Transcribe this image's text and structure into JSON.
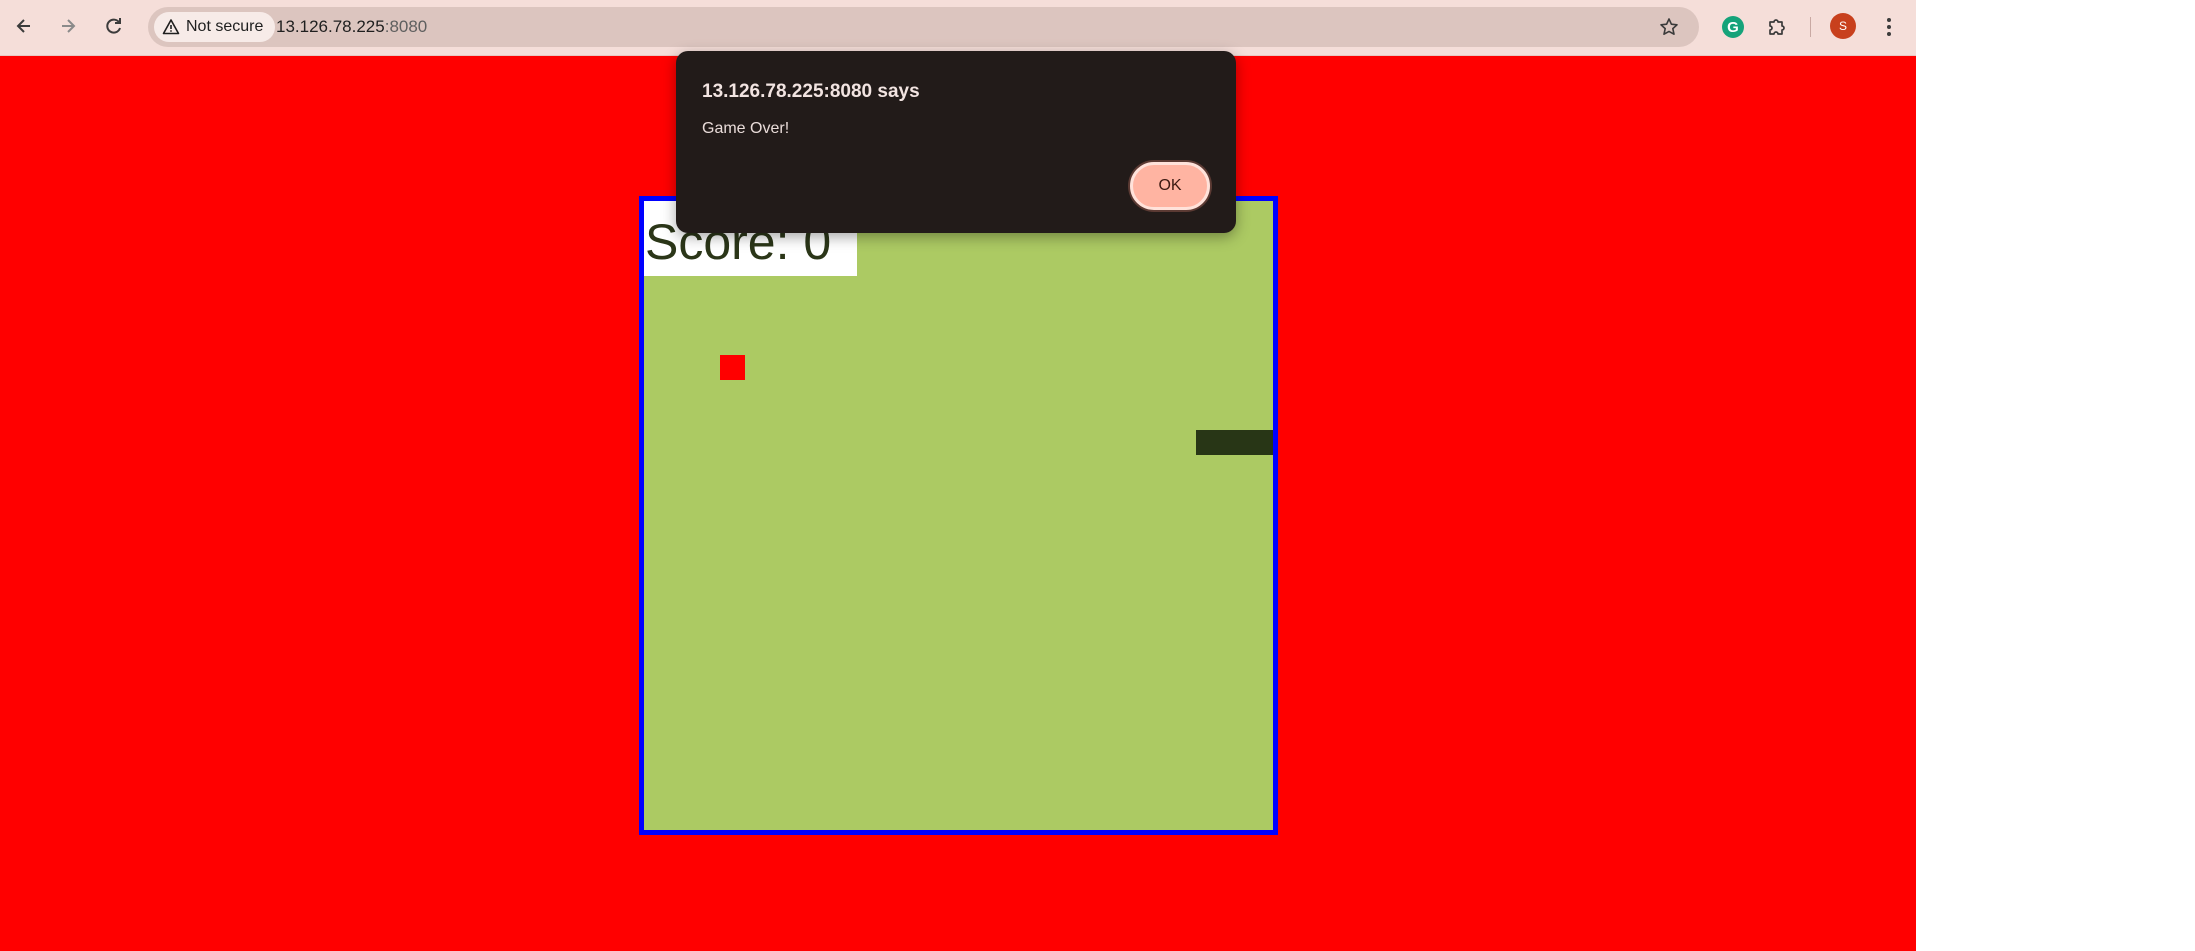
{
  "browser": {
    "security_label": "Not secure",
    "url_host": "13.126.78.225",
    "url_port": ":8080",
    "avatar_letter": "S",
    "icons": [
      "back-arrow-icon",
      "forward-arrow-icon",
      "reload-icon",
      "warning-icon",
      "star-icon",
      "grammarly-icon",
      "puzzle-icon",
      "more-vert-icon"
    ]
  },
  "game": {
    "score_label": "Score: 0",
    "colors": {
      "page_bg": "#ff0000",
      "board": "#acca63",
      "border": "#0000ff",
      "food": "#ff0000",
      "snake": "#283616"
    }
  },
  "alert": {
    "title": "13.126.78.225:8080 says",
    "message": "Game Over!",
    "ok_label": "OK"
  }
}
